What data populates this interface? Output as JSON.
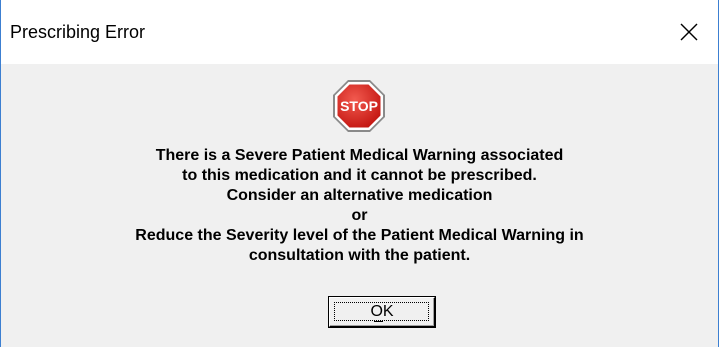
{
  "dialog": {
    "title": "Prescribing Error",
    "close_icon": "close-icon",
    "stop_icon": {
      "name": "stop-sign-icon",
      "text": "STOP",
      "color": "#d9221c"
    },
    "message_lines": [
      "There is a Severe Patient Medical Warning associated",
      "to this medication and it cannot be prescribed.",
      "Consider an alternative medication",
      "or",
      "Reduce the Severity level of the Patient Medical Warning in",
      "consultation with the patient."
    ],
    "ok_label": "OK",
    "ok_accelerator": "O"
  },
  "colors": {
    "window_border": "#3c7fd1",
    "titlebar_bg": "#ffffff",
    "client_bg": "#f0f0f0"
  }
}
